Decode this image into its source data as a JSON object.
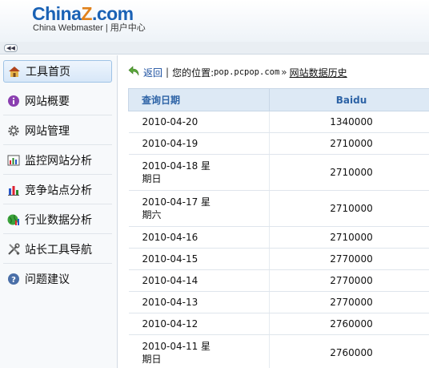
{
  "header": {
    "logo_part1": "China",
    "logo_part2": "Z",
    "logo_part3": ".com",
    "subtitle": "China Webmaster | 用户中心"
  },
  "toggle": {
    "icon": "double-chevron-left-icon",
    "glyph": "◀◀"
  },
  "sidebar": {
    "items": [
      {
        "label": "工具首页",
        "icon": "home-icon",
        "active": true
      },
      {
        "label": "网站概要",
        "icon": "info-icon",
        "active": false
      },
      {
        "label": "网站管理",
        "icon": "gear-icon",
        "active": false
      },
      {
        "label": "监控网站分析",
        "icon": "bar-chart-icon",
        "active": false
      },
      {
        "label": "竞争站点分析",
        "icon": "column-chart-icon",
        "active": false
      },
      {
        "label": "行业数据分析",
        "icon": "globe-chart-icon",
        "active": false
      },
      {
        "label": "站长工具导航",
        "icon": "tools-icon",
        "active": false
      },
      {
        "label": "问题建议",
        "icon": "help-icon",
        "active": false
      }
    ]
  },
  "breadcrumb": {
    "back_label": "返回",
    "separator": "|",
    "location_label": "您的位置:",
    "site": "pop.pcpop.com",
    "arrow": "»",
    "current": "网站数据历史"
  },
  "table": {
    "headers": [
      "查询日期",
      "Baidu"
    ],
    "rows": [
      {
        "date": "2010-04-20",
        "value": "1340000"
      },
      {
        "date": "2010-04-19",
        "value": "2710000"
      },
      {
        "date": "2010-04-18 星期日",
        "value": "2710000"
      },
      {
        "date": "2010-04-17 星期六",
        "value": "2710000"
      },
      {
        "date": "2010-04-16",
        "value": "2710000"
      },
      {
        "date": "2010-04-15",
        "value": "2770000"
      },
      {
        "date": "2010-04-14",
        "value": "2770000"
      },
      {
        "date": "2010-04-13",
        "value": "2770000"
      },
      {
        "date": "2010-04-12",
        "value": "2760000"
      },
      {
        "date": "2010-04-11 星期日",
        "value": "2760000"
      }
    ]
  },
  "colors": {
    "brand_blue": "#1a62b5",
    "brand_orange": "#e1821c",
    "header_text": "#2d63a6",
    "link": "#1a4fa0"
  }
}
